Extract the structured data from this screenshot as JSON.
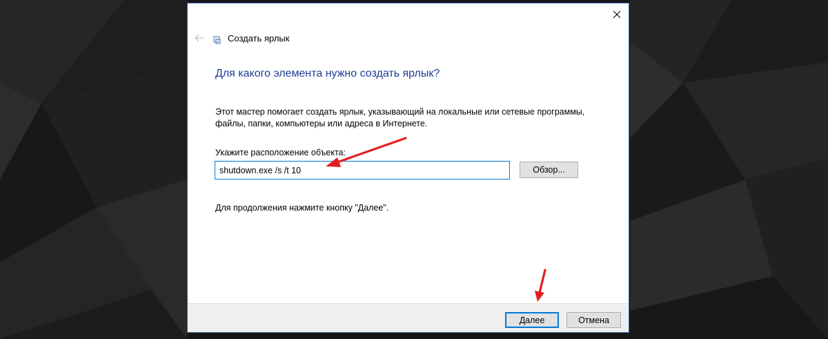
{
  "dialog": {
    "title": "Создать ярлык",
    "heading": "Для какого элемента нужно создать ярлык?",
    "description": "Этот мастер помогает создать ярлык, указывающий на локальные или сетевые программы, файлы, папки, компьютеры или адреса в Интернете.",
    "location_label": "Укажите расположение объекта:",
    "location_value": "shutdown.exe /s /t 10",
    "browse_label": "Обзор...",
    "continue_hint": "Для продолжения нажмите кнопку \"Далее\".",
    "next_label": "Далее",
    "cancel_label": "Отмена"
  },
  "icons": {
    "close": "close-icon",
    "back": "back-arrow-icon",
    "wizard": "shortcut-wizard-icon"
  },
  "colors": {
    "heading": "#1f3c97",
    "focus_border": "#0078d7",
    "annotation_arrow": "#e02020",
    "backdrop": "#1a1a1a"
  }
}
